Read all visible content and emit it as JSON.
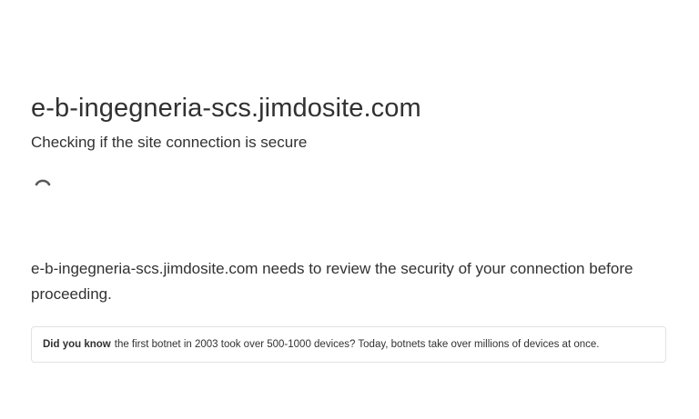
{
  "header": {
    "site_title": "e-b-ingegneria-scs.jimdosite.com",
    "checking_text": "Checking if the site connection is secure"
  },
  "main": {
    "review_text": "e-b-ingegneria-scs.jimdosite.com needs to review the security of your connection before proceeding."
  },
  "tip": {
    "label": "Did you know",
    "text": "the first botnet in 2003 took over 500-1000 devices? Today, botnets take over millions of devices at once."
  },
  "icons": {
    "spinner": "loading-spinner-icon"
  },
  "colors": {
    "text": "#313131",
    "border": "#e2e2e2",
    "spinner": "#595959"
  }
}
